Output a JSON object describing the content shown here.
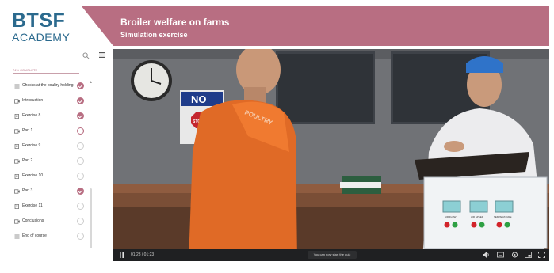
{
  "brand": {
    "line1": "BTSF",
    "line2": "ACADEMY"
  },
  "header": {
    "title": "Broiler welfare on farms",
    "subtitle": "Simulation exercise"
  },
  "sidebar": {
    "progress_label": "74% COMPLETE",
    "items": [
      {
        "label": "Checks at the poultry holding",
        "type": "quiz",
        "status": "complete"
      },
      {
        "label": "Introduction",
        "type": "video",
        "status": "complete"
      },
      {
        "label": "Exercise 8",
        "type": "doc",
        "status": "complete"
      },
      {
        "label": "Part 1",
        "type": "video",
        "status": "partial"
      },
      {
        "label": "Exercise 9",
        "type": "doc",
        "status": "empty"
      },
      {
        "label": "Part 2",
        "type": "video",
        "status": "empty"
      },
      {
        "label": "Exercise 10",
        "type": "doc",
        "status": "empty"
      },
      {
        "label": "Part 3",
        "type": "video",
        "status": "complete"
      },
      {
        "label": "Exercise 11",
        "type": "doc",
        "status": "empty"
      },
      {
        "label": "Conclusions",
        "type": "video",
        "status": "empty"
      },
      {
        "label": "End of course",
        "type": "quiz",
        "status": "empty"
      }
    ]
  },
  "video": {
    "scene": {
      "wall_sign": "NO",
      "stop_sign": "STOP",
      "jacket_text": "POULTRY",
      "panel_labels": [
        "AIR FLOW",
        "AIR SPEED",
        "TEMPERATURE"
      ]
    },
    "controls": {
      "time": "01:23 / 01:23",
      "caption": "You can now start the quiz"
    }
  },
  "colors": {
    "brand_blue": "#2b6a8e",
    "accent": "#b86e82",
    "control_bar": "#1f2022"
  }
}
